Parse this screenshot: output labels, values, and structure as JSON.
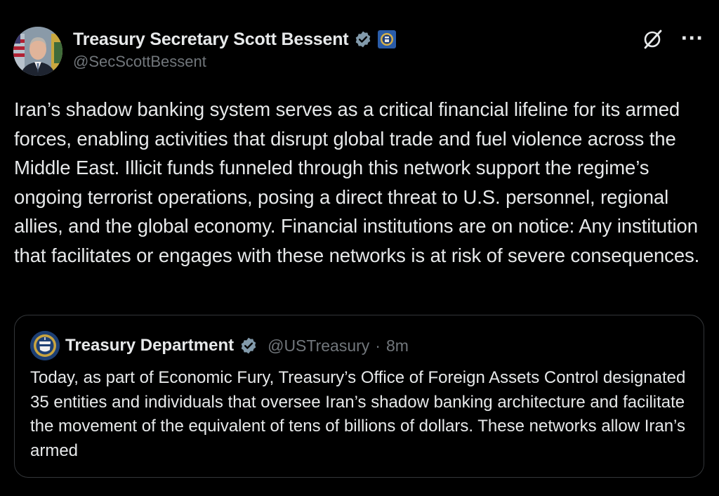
{
  "post": {
    "author_name": "Treasury Secretary Scott Bessent",
    "author_handle": "@SecScottBessent",
    "text": "Iran’s shadow banking system serves as a critical financial lifeline for its armed forces, enabling activities that disrupt global trade and fuel violence across the Middle East. Illicit funds funneled through this network support the regime’s ongoing terrorist operations, posing a direct threat to U.S. personnel, regional allies, and the global economy. Financial institutions are on notice: Any institution that facilitates or engages with these networks is at risk of severe consequences.",
    "verified_badge_color": "#829aab",
    "icons": [
      "verified-badge-icon",
      "treasury-seal-icon",
      "grok-icon",
      "more-icon"
    ]
  },
  "quote": {
    "author_name": "Treasury Department",
    "author_handle": "@USTreasury",
    "separator": "·",
    "time": "8m",
    "text": "Today, as part of Economic Fury, Treasury’s Office of Foreign Assets Control designated 35 entities and individuals that oversee Iran’s shadow banking architecture and facilitate the movement of the equivalent of tens of billions of dollars. These networks allow Iran’s armed"
  },
  "colors": {
    "background": "#000000",
    "text_primary": "#e7e9ea",
    "text_secondary": "#71767b",
    "border": "#333639"
  }
}
